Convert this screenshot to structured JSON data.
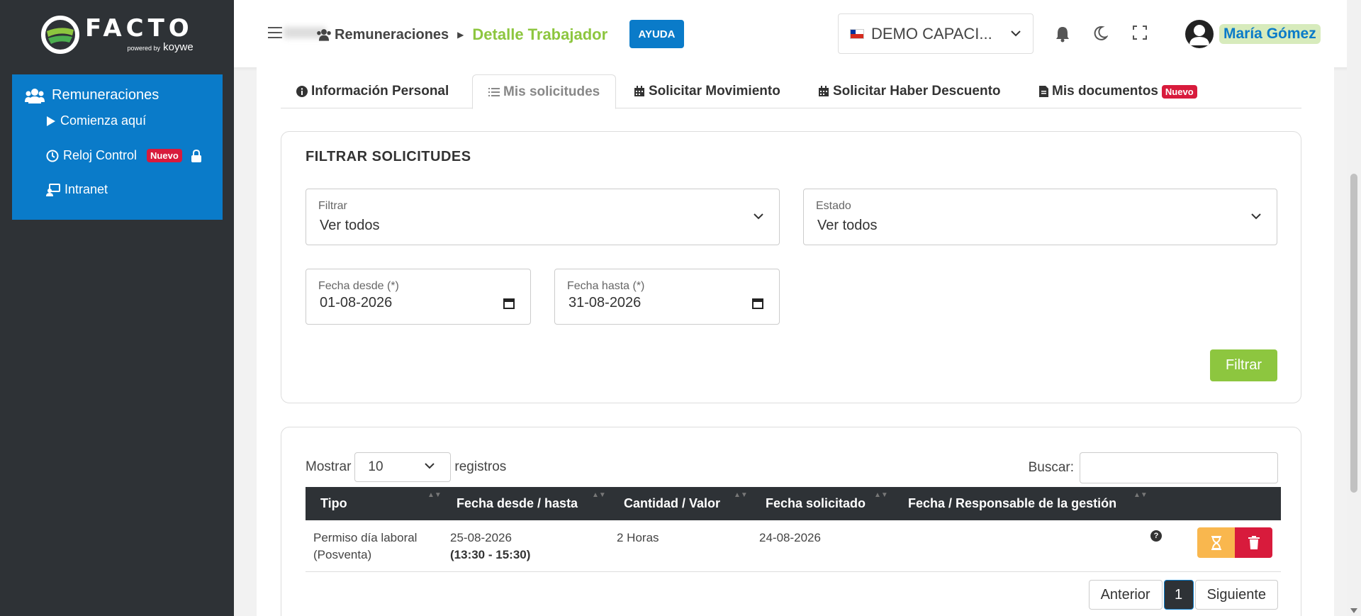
{
  "brand": {
    "name": "FACTO",
    "powered_by": "powered by",
    "powered_name": "koywe"
  },
  "sidebar": {
    "section_label": "Remuneraciones",
    "items": [
      {
        "label": "Comienza aquí"
      },
      {
        "label": "Reloj Control",
        "badge": "Nuevo"
      },
      {
        "label": "Intranet"
      }
    ]
  },
  "header": {
    "breadcrumb_parent": "Remuneraciones",
    "breadcrumb_current": "Detalle Trabajador",
    "help_label": "AYUDA",
    "company_name": "DEMO CAPACI...",
    "user_name": "María Gómez"
  },
  "tabs": [
    {
      "label": "Información Personal"
    },
    {
      "label": "Mis solicitudes"
    },
    {
      "label": "Solicitar Movimiento"
    },
    {
      "label": "Solicitar Haber Descuento"
    },
    {
      "label": "Mis documentos",
      "badge": "Nuevo"
    }
  ],
  "filter": {
    "title": "FILTRAR SOLICITUDES",
    "filtrar_label": "Filtrar",
    "filtrar_value": "Ver todos",
    "estado_label": "Estado",
    "estado_value": "Ver todos",
    "fecha_desde_label": "Fecha desde (*)",
    "fecha_desde_value": "01-08-2026",
    "fecha_hasta_label": "Fecha hasta (*)",
    "fecha_hasta_value": "31-08-2026",
    "submit_label": "Filtrar"
  },
  "table": {
    "show_label": "Mostrar",
    "page_size": "10",
    "records_label": "registros",
    "search_label": "Buscar:",
    "columns": [
      "Tipo",
      "Fecha desde / hasta",
      "Cantidad / Valor",
      "Fecha solicitado",
      "Fecha / Responsable de la gestión"
    ],
    "rows": [
      {
        "tipo_line1": "Permiso día laboral",
        "tipo_line2": "(Posventa)",
        "fecha_line1": "25-08-2026",
        "fecha_line2": "(13:30 - 15:30)",
        "cantidad": "2 Horas",
        "solicitado": "24-08-2026",
        "help": "?"
      }
    ]
  },
  "pagination": {
    "prev": "Anterior",
    "current": "1",
    "next": "Siguiente"
  },
  "colors": {
    "sidebar_bg": "#2e3236",
    "accent_blue": "#0a7bc9",
    "accent_green": "#8dc63f",
    "badge_red": "#d81b3c",
    "pending_orange": "#f9b74e"
  },
  "icons": [
    "users-icon",
    "play-icon",
    "clock-icon",
    "lock-icon",
    "intranet-icon",
    "menu-icon",
    "chile-flag-icon",
    "chevron-down-icon",
    "bell-icon",
    "moon-icon",
    "fullscreen-icon",
    "avatar-icon",
    "info-icon",
    "list-icon",
    "calendar-icon",
    "file-icon",
    "hourglass-icon",
    "trash-icon",
    "question-icon",
    "sort-icon"
  ]
}
